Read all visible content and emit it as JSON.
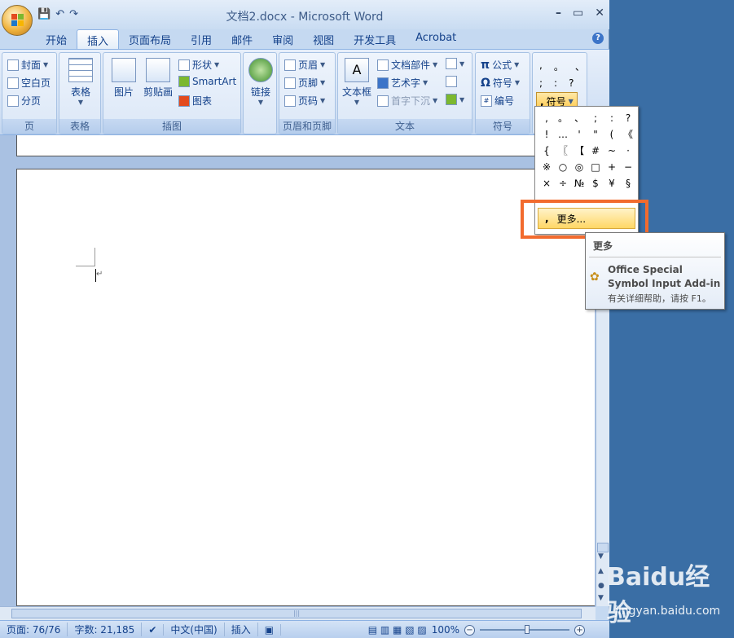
{
  "window": {
    "title": "文档2.docx - Microsoft Word"
  },
  "qat": {
    "save": "💾",
    "undo": "↶",
    "redo": "↷"
  },
  "tabs": [
    "开始",
    "插入",
    "页面布局",
    "引用",
    "邮件",
    "审阅",
    "视图",
    "开发工具",
    "Acrobat"
  ],
  "ribbon": {
    "page_group": {
      "label": "页",
      "cover": "封面",
      "blank": "空白页",
      "break": "分页"
    },
    "table_group": {
      "label": "表格",
      "table": "表格"
    },
    "illus_group": {
      "label": "插图",
      "picture": "图片",
      "clipart": "剪贴画",
      "shapes": "形状",
      "smartart": "SmartArt",
      "chart": "图表"
    },
    "link_group": {
      "link": "链接"
    },
    "header_group": {
      "label": "页眉和页脚",
      "header": "页眉",
      "footer": "页脚",
      "pagenum": "页码"
    },
    "text_group": {
      "label": "文本",
      "textbox": "文本框",
      "parts": "文档部件",
      "wordart": "艺术字",
      "dropcap": "首字下沉"
    },
    "symbol_group": {
      "label": "符号",
      "equation": "公式",
      "symbol": "符号",
      "number": "编号"
    },
    "special_group": {
      "symbol_btn": "符号",
      "row1": [
        ",",
        "。",
        "、"
      ],
      "row2": [
        ";",
        ":",
        "?"
      ]
    }
  },
  "dropdown": {
    "symbols": [
      ",",
      "。",
      "、",
      ";",
      ":",
      "?",
      "!",
      "…",
      "'",
      "\"",
      "(",
      "《",
      "{",
      "〖",
      "【",
      "#",
      "~",
      "·",
      "※",
      "○",
      "◎",
      "□",
      "+",
      "−",
      "×",
      "÷",
      "№",
      "$",
      "¥",
      "§"
    ],
    "more": "更多..."
  },
  "tooltip": {
    "title": "更多",
    "addin": "Office Special Symbol Input Add-in",
    "help": "有关详细帮助，请按 F1。"
  },
  "status": {
    "page": "页面: 76/76",
    "words": "字数: 21,185",
    "lang": "中文(中国)",
    "mode": "插入",
    "zoom": "100%"
  },
  "watermark": {
    "brand": "Baidu经验",
    "url": "jingyan.baidu.com"
  }
}
